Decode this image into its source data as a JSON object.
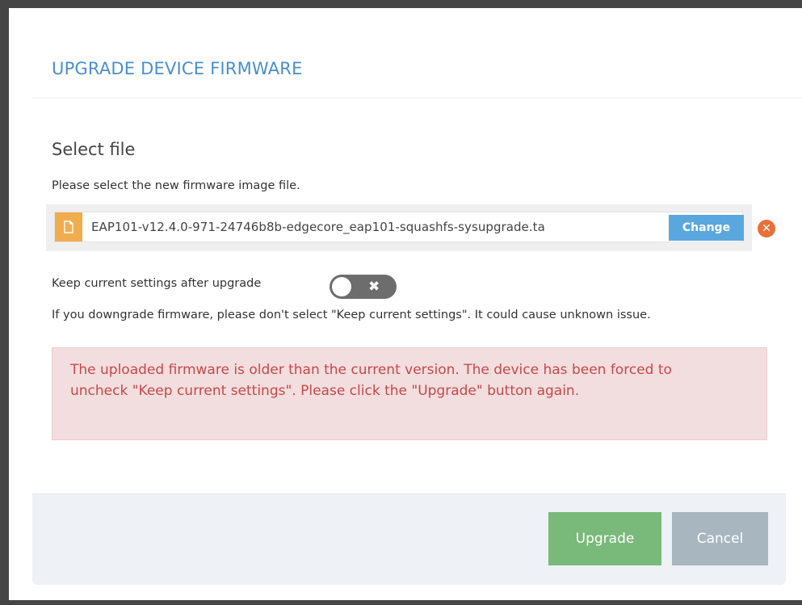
{
  "dialog": {
    "title": "UPGRADE DEVICE FIRMWARE",
    "section_title": "Select file",
    "hint": "Please select the new firmware image file."
  },
  "file": {
    "name": "EAP101-v12.4.0-971-24746b8b-edgecore_eap101-squashfs-sysupgrade.ta",
    "change_label": "Change",
    "icon": "file-icon",
    "remove_icon": "times-circle-icon"
  },
  "keep_settings": {
    "label": "Keep current settings after upgrade",
    "enabled": false,
    "toggle_icon": "x-icon"
  },
  "warning_text": "If you downgrade firmware, please don't select \"Keep current settings\". It could cause unknown issue.",
  "alert": {
    "text": "The uploaded firmware is older than the current version. The device has been forced to uncheck \"Keep current settings\". Please click the \"Upgrade\" button again."
  },
  "footer": {
    "upgrade_label": "Upgrade",
    "cancel_label": "Cancel"
  },
  "colors": {
    "title": "#4a8fcc",
    "change_button": "#5aa7de",
    "file_icon_bg": "#f0ad4e",
    "remove_icon": "#e8703a",
    "alert_bg": "#f2dede",
    "alert_text": "#c6484a",
    "upgrade_button": "#79b97a",
    "cancel_button": "#a8b6bf"
  }
}
